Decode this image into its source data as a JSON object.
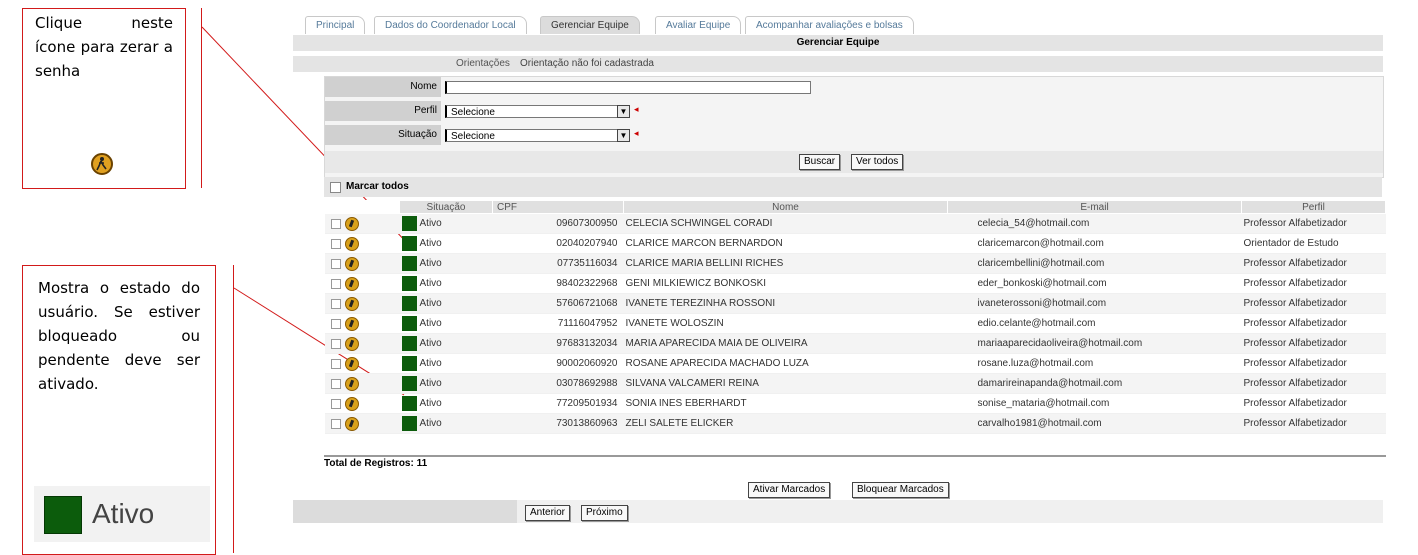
{
  "callouts": {
    "reset_password": "Clique neste ícone para zerar a senha",
    "status": "Mostra o estado do usuário. Se estiver bloqueado ou pendente deve ser ativado.",
    "status_sample_label": "Ativo"
  },
  "tabs": [
    "Principal",
    "Dados do Coordenador Local",
    "Gerenciar Equipe",
    "Avaliar Equipe",
    "Acompanhar avaliações e bolsas"
  ],
  "section_title": "Gerenciar Equipe",
  "orientations": {
    "label": "Orientações",
    "value": "Orientação não foi cadastrada"
  },
  "form": {
    "name_label": "Nome",
    "name_value": "",
    "profile_label": "Perfil",
    "profile_value": "Selecione",
    "status_label": "Situação",
    "status_value": "Selecione",
    "search_button": "Buscar",
    "all_button": "Ver todos"
  },
  "mark_all": "Marcar todos",
  "table": {
    "headers": [
      "Situação",
      "CPF",
      "Nome",
      "E-mail",
      "Perfil"
    ],
    "rows": [
      {
        "status": "Ativo",
        "cpf": "09607300950",
        "name": "CELECIA SCHWINGEL CORADI",
        "email": "celecia_54@hotmail.com",
        "profile": "Professor Alfabetizador"
      },
      {
        "status": "Ativo",
        "cpf": "02040207940",
        "name": "CLARICE MARCON BERNARDON",
        "email": "claricemarcon@hotmail.com",
        "profile": "Orientador de Estudo"
      },
      {
        "status": "Ativo",
        "cpf": "07735116034",
        "name": "CLARICE MARIA BELLINI RICHES",
        "email": "claricembellini@hotmail.com",
        "profile": "Professor Alfabetizador"
      },
      {
        "status": "Ativo",
        "cpf": "98402322968",
        "name": "GENI MILKIEWICZ BONKOSKI",
        "email": "eder_bonkoski@hotmail.com",
        "profile": "Professor Alfabetizador"
      },
      {
        "status": "Ativo",
        "cpf": "57606721068",
        "name": "IVANETE TEREZINHA ROSSONI",
        "email": "ivaneterossoni@hotmail.com",
        "profile": "Professor Alfabetizador"
      },
      {
        "status": "Ativo",
        "cpf": "71116047952",
        "name": "IVANETE WOLOSZIN",
        "email": "edio.celante@hotmail.com",
        "profile": "Professor Alfabetizador"
      },
      {
        "status": "Ativo",
        "cpf": "97683132034",
        "name": "MARIA APARECIDA MAIA DE OLIVEIRA",
        "email": "mariaaparecidaoliveira@hotmail.com",
        "profile": "Professor Alfabetizador"
      },
      {
        "status": "Ativo",
        "cpf": "90002060920",
        "name": "ROSANE APARECIDA MACHADO LUZA",
        "email": "rosane.luza@hotmail.com",
        "profile": "Professor Alfabetizador"
      },
      {
        "status": "Ativo",
        "cpf": "03078692988",
        "name": "SILVANA VALCAMERI REINA",
        "email": "damarireinapanda@hotmail.com",
        "profile": "Professor Alfabetizador"
      },
      {
        "status": "Ativo",
        "cpf": "77209501934",
        "name": "SONIA INES EBERHARDT",
        "email": "sonise_mataria@hotmail.com",
        "profile": "Professor Alfabetizador"
      },
      {
        "status": "Ativo",
        "cpf": "73013860963",
        "name": "ZELI SALETE ELICKER",
        "email": "carvalho1981@hotmail.com",
        "profile": "Professor Alfabetizador"
      }
    ]
  },
  "total": "Total de Registros: 11",
  "actions": {
    "activate": "Ativar Marcados",
    "block": "Bloquear Marcados"
  },
  "pagination": {
    "prev": "Anterior",
    "next": "Próximo"
  },
  "colors": {
    "callout_border": "#d21a1a",
    "active_green": "#0c5c0c",
    "link_blue": "#3a6aa6"
  }
}
